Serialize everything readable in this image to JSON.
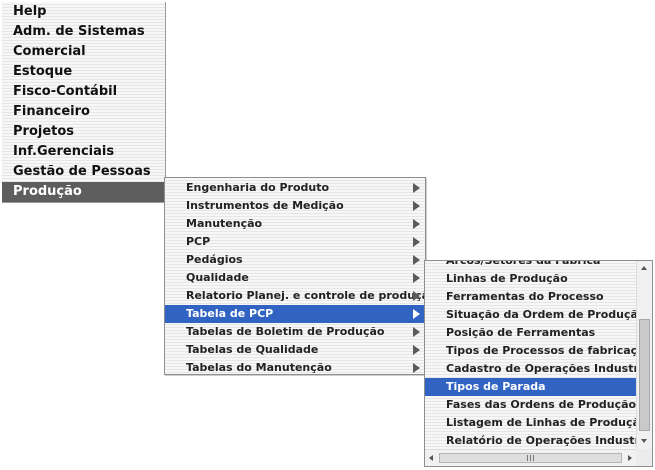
{
  "main_menu": {
    "items": [
      {
        "label": "Help"
      },
      {
        "label": "Adm. de Sistemas"
      },
      {
        "label": "Comercial"
      },
      {
        "label": "Estoque"
      },
      {
        "label": "Fisco-Contábil"
      },
      {
        "label": "Financeiro"
      },
      {
        "label": "Projetos"
      },
      {
        "label": "Inf.Gerenciais"
      },
      {
        "label": "Gestão de Pessoas"
      },
      {
        "label": "Produção",
        "active": true
      }
    ]
  },
  "submenu_producao": {
    "items": [
      {
        "label": "Engenharia do Produto"
      },
      {
        "label": "Instrumentos de Medição"
      },
      {
        "label": "Manutenção"
      },
      {
        "label": "PCP"
      },
      {
        "label": "Pedágios"
      },
      {
        "label": "Qualidade"
      },
      {
        "label": "Relatorio Planej. e controle de produção"
      },
      {
        "label": "Tabela de PCP",
        "active": true
      },
      {
        "label": "Tabelas de Boletim de Produção"
      },
      {
        "label": "Tabelas de Qualidade"
      },
      {
        "label": "Tabelas do Manutenção"
      }
    ]
  },
  "submenu_tabela_pcp": {
    "items": [
      {
        "label": "Arcos/Setores da Fábrica"
      },
      {
        "label": "Linhas de Produção"
      },
      {
        "label": "Ferramentas do Processo"
      },
      {
        "label": "Situação da Ordem de Produção"
      },
      {
        "label": "Posição de Ferramentas"
      },
      {
        "label": "Tipos de Processos de fabricação"
      },
      {
        "label": "Cadastro de Operações Industriais"
      },
      {
        "label": "Tipos de Parada",
        "active": true
      },
      {
        "label": "Fases das Ordens de Produção (O"
      },
      {
        "label": "Listagem de Linhas de Produção"
      },
      {
        "label": "Relatório de Operações Industriais"
      }
    ]
  },
  "colors": {
    "menu_background": "#efefef",
    "main_active": "#5e5e5e",
    "highlight": "#3163c2"
  },
  "icons": {
    "submenu_arrow": "triangle-right",
    "scroll_up": "triangle-up",
    "scroll_down": "triangle-down",
    "scroll_left": "triangle-left",
    "scroll_right": "triangle-right"
  }
}
